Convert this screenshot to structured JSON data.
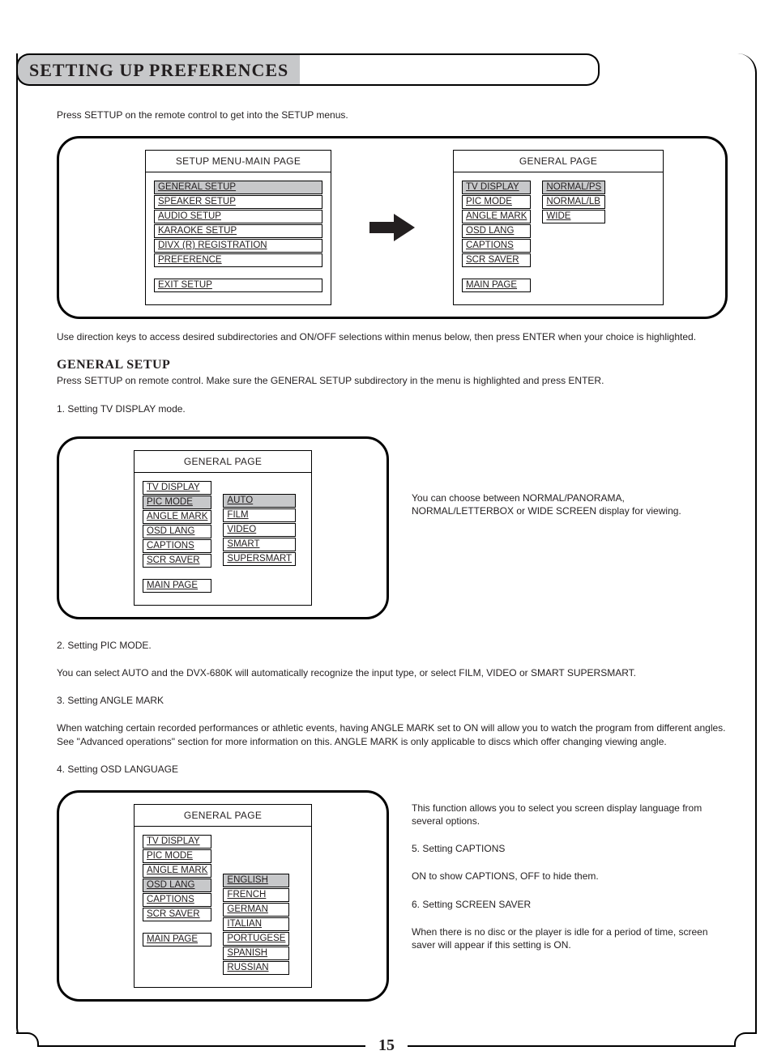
{
  "banner": "SETTING UP PREFERENCES",
  "intro": "Press SETTUP on the remote control to get into the SETUP menus.",
  "diagram1": {
    "left": {
      "title": "SETUP MENU-MAIN PAGE",
      "items": [
        "GENERAL SETUP",
        "SPEAKER SETUP",
        "AUDIO SETUP",
        "KARAOKE SETUP",
        "DIVX (R) REGISTRATION",
        "PREFERENCE"
      ],
      "exit": "EXIT SETUP"
    },
    "right": {
      "title": "GENERAL PAGE",
      "col1": [
        "TV DISPLAY",
        "PIC MODE",
        "ANGLE MARK",
        "OSD LANG",
        "CAPTIONS",
        "SCR SAVER"
      ],
      "main": "MAIN PAGE",
      "col2": [
        "NORMAL/PS",
        "NORMAL/LB",
        "WIDE"
      ]
    }
  },
  "after1": "Use direction keys to access desired subdirectories and ON/OFF selections within menus below, then press ENTER when your choice is highlighted.",
  "general": {
    "head": "GENERAL SETUP",
    "lead": "Press SETTUP on remote control.  Make sure the GENERAL SETUP subdirectory in the menu is highlighted and press ENTER.",
    "step1": "1. Setting TV DISPLAY mode.",
    "box2": {
      "title": "GENERAL PAGE",
      "col1": [
        "TV DISPLAY",
        "PIC MODE",
        "ANGLE MARK",
        "OSD LANG",
        "CAPTIONS",
        "SCR SAVER"
      ],
      "main": "MAIN PAGE",
      "col2": [
        "AUTO",
        "FILM",
        "VIDEO",
        "SMART",
        "SUPERSMART"
      ]
    },
    "step1_desc": "You can choose between NORMAL/PANORAMA, NORMAL/LETTERBOX or WIDE SCREEN display for viewing.",
    "step2": "2. Setting PIC MODE.",
    "step2_desc": "You can select AUTO and the DVX-680K will automatically recognize the input type, or select FILM, VIDEO or SMART SUPERSMART.",
    "step3": "3. Setting ANGLE MARK",
    "step3_desc": "When watching certain recorded performances or athletic events, having ANGLE MARK set to ON will allow you to watch the program from different angles.  See \"Advanced operations\" section for more information on this.  ANGLE MARK is only applicable to discs which offer changing viewing angle.",
    "step4": "4. Setting OSD LANGUAGE",
    "box3": {
      "title": "GENERAL PAGE",
      "col1": [
        "TV DISPLAY",
        "PIC MODE",
        "ANGLE MARK",
        "OSD LANG",
        "CAPTIONS",
        "SCR SAVER"
      ],
      "main": "MAIN PAGE",
      "col2": [
        "ENGLISH",
        "FRENCH",
        "GERMAN",
        "ITALIAN",
        "PORTUGESE",
        "SPANISH",
        "RUSSIAN"
      ]
    },
    "step4_desc": "This function allows you to select you screen display language from several options.",
    "step5": "5. Setting CAPTIONS",
    "step5_desc": "ON to show CAPTIONS, OFF to hide them.",
    "step6": "6. Setting SCREEN SAVER",
    "step6_desc": "When there is no disc or the player is idle for a period of time, screen saver will appear if this setting is ON."
  },
  "page_number": "15"
}
